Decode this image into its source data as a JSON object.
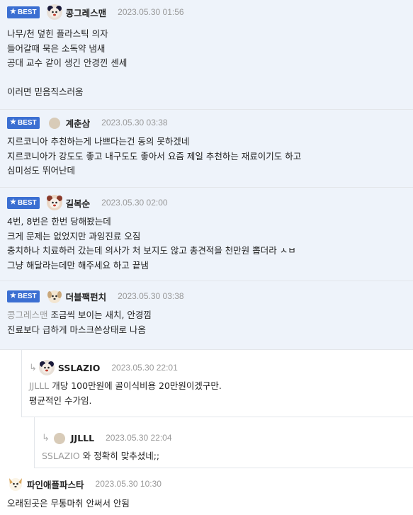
{
  "badge_label": "BEST",
  "comments": [
    {
      "nick": "콩그레스맨",
      "date": "2023.05.30 01:56",
      "lines": [
        "나무/천 덮힌 플라스틱 의자",
        "들어갈때 묵은 소독약 냄새",
        "공대 교수 같이 생긴 안경낀 센세",
        "",
        "이러면 믿음직스러움"
      ]
    },
    {
      "nick": "계춘삼",
      "date": "2023.05.30 03:38",
      "lines": [
        "지르코니아 추천하는게 나쁘다는건 동의 못하겠네",
        "지르코니아가 강도도 좋고 내구도도 좋아서 요즘 제일 추천하는 재료이기도 하고",
        "심미성도 뛰어난데"
      ]
    },
    {
      "nick": "길복순",
      "date": "2023.05.30 02:00",
      "lines": [
        "4번, 8번은 한번 당해봤는데",
        "크게 문제는 없었지만 과잉진료 오짐",
        "충치하나 치료하러 갔는데 의사가 처 보지도 않고 총견적을 천만원 뽑더라 ㅅㅂ",
        "그냥 해달라는데만 해주세요 하고 끝냄"
      ]
    },
    {
      "nick": "더블팩펀치",
      "date": "2023.05.30 03:38",
      "mention": "콩그레스맨",
      "lines": [
        "조금씩 보이는 새치, 안경낌",
        "진료보다 급하게 마스크쓴상태로 나옴"
      ]
    },
    {
      "nick": "SSLAZIO",
      "date": "2023.05.30 22:01",
      "mention": "JJLLL",
      "lines": [
        "개당 100만원에 골이식비용 20만원이겠구만.",
        "평균적인 수가임."
      ]
    },
    {
      "nick": "JJLLL",
      "date": "2023.05.30 22:04",
      "mention": "SSLAZIO",
      "lines": [
        "와 정확히 맞추셨네;;"
      ]
    },
    {
      "nick": "파인애플파스타",
      "date": "2023.05.30 10:30",
      "lines": [
        "오래된곳은 무통마취 안써서 안됨"
      ]
    }
  ],
  "reply_arrow_icon": "reply-arrow-icon",
  "colors": {
    "best_bg": "#eef3fa",
    "badge": "#3b6fd2",
    "date": "#999999",
    "mention": "#999999"
  }
}
